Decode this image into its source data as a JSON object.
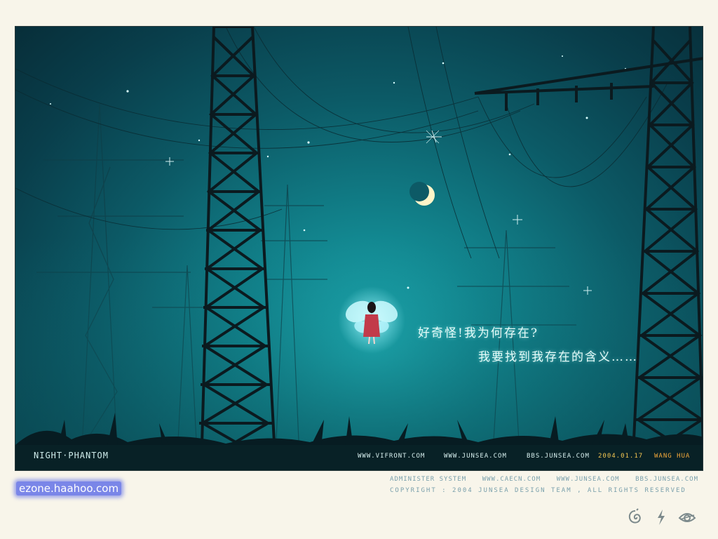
{
  "artwork": {
    "title": "NIGHT·PHANTOM",
    "caption_line_1": "好奇怪!我为何存在?",
    "caption_line_2": "我要找到我存在的含义……",
    "links": [
      "WWW.VIFRONT.COM",
      "WWW.JUNSEA.COM",
      "BBS.JUNSEA.COM"
    ],
    "date": "2004.01.17",
    "author": "WANG HUA"
  },
  "footer": {
    "links": [
      "ADMINISTER SYSTEM",
      "WWW.CAECN.COM",
      "WWW.JUNSEA.COM",
      "BBS.JUNSEA.COM"
    ],
    "copyright": "COPYRIGHT : 2004 JUNSEA DESIGN TEAM , ALL RIGHTS RESERVED",
    "site": "ezone.haahoo.com",
    "icons": [
      "spiral-icon",
      "lightning-icon",
      "eye-icon"
    ]
  },
  "colors": {
    "page_background": "#f8f5ea",
    "sky_glow": "#1fb2b8",
    "sky_dark": "#072e39",
    "tower": "#0b1a1f",
    "date_text": "#f2c451",
    "author_text": "#f2a83a",
    "footer_text": "#7aa0ac",
    "site_badge": "#7a86e8"
  }
}
